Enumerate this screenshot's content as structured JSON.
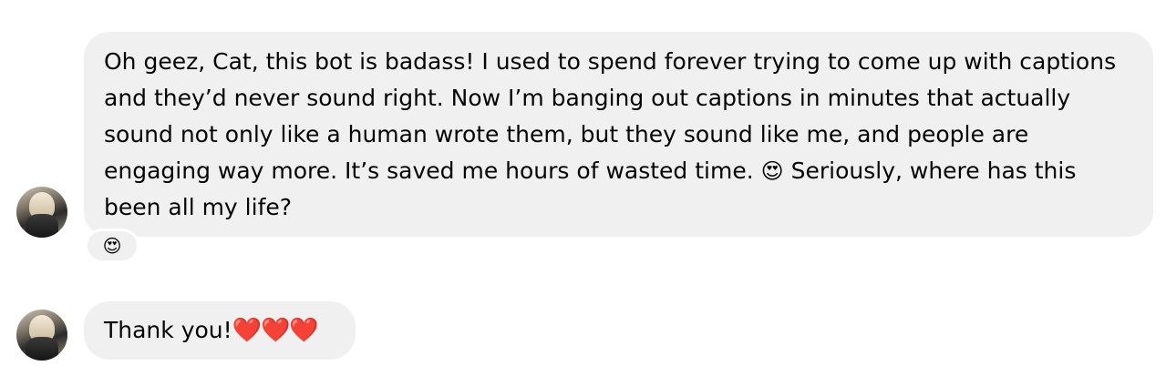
{
  "messages": [
    {
      "text_before_emoji": "Oh geez, Cat, this bot is badass! I used to spend forever trying to come up with captions and they’d never sound right. Now I’m banging out captions in minutes that actually sound not only like a human wrote them, but they sound like me, and people are engaging way more. It’s saved me hours of wasted time.",
      "inline_emoji": "😍",
      "text_after_emoji": "Seriously, where has this been all my life?",
      "reaction": "😍",
      "avatar_icon": "avatar-photo"
    },
    {
      "text": "Thank you!",
      "hearts": "❤️❤️❤️",
      "avatar_icon": "avatar-photo"
    }
  ],
  "colors": {
    "bubble": "#f0f0f0",
    "text": "#050505",
    "heart": "#e0245e"
  }
}
